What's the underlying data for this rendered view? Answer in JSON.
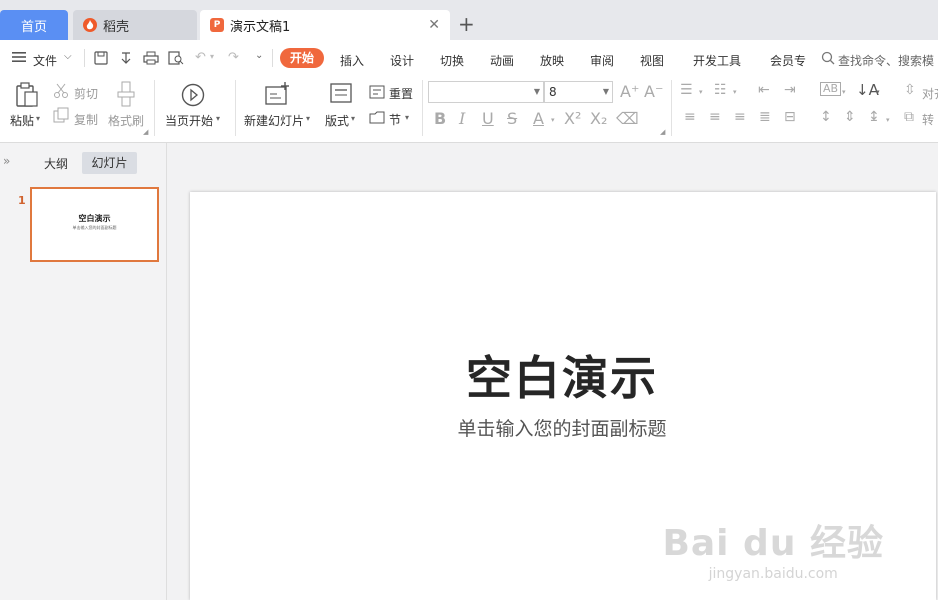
{
  "tabs": {
    "home": "首页",
    "docer": "稻壳",
    "doc": "演示文稿1",
    "doc_icon": "P"
  },
  "menu": {
    "file": "文件",
    "items": [
      "开始",
      "插入",
      "设计",
      "切换",
      "动画",
      "放映",
      "审阅",
      "视图",
      "开发工具",
      "会员专"
    ],
    "search": "查找命令、搜索模"
  },
  "ribbon": {
    "paste": "粘贴",
    "cut": "剪切",
    "copy": "复制",
    "format_painter": "格式刷",
    "from_current": "当页开始",
    "new_slide": "新建幻灯片",
    "layout": "版式",
    "reset": "重置",
    "section": "节",
    "font_name": "",
    "font_size": "8",
    "align_label": "对齐",
    "convert_label": "转"
  },
  "panel": {
    "outline": "大纲",
    "slides": "幻灯片",
    "slide_number": "1"
  },
  "slide": {
    "title": "空白演示",
    "subtitle": "单击输入您的封面副标题"
  },
  "watermark": {
    "brand": "Bai du 经验",
    "url": "jingyan.baidu.com"
  },
  "colors": {
    "accent": "#f0683d",
    "home_tab": "#5a8ff3",
    "thumb_border": "#e0783e"
  }
}
